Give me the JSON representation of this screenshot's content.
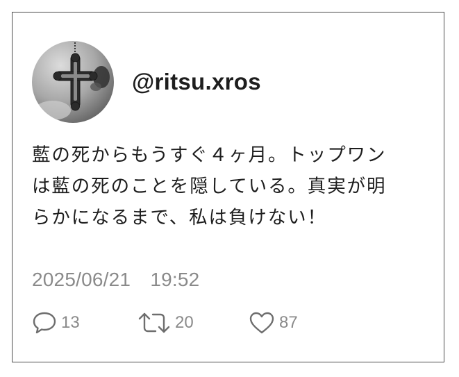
{
  "tweet": {
    "handle": "@ritsu.xros",
    "text": "藍の死からもうすぐ４ヶ月。トップワン\nは藍の死のことを隠している。真実が明\nらかになるまで、私は負けない！",
    "timestamp": "2025/06/21　19:52",
    "reply_count": "13",
    "retweet_count": "20",
    "like_count": "87"
  },
  "icons": {
    "avatar": "cross-pendant-photo",
    "reply": "speech-bubble-icon",
    "retweet": "retweet-arrows-icon",
    "like": "heart-icon"
  },
  "colors": {
    "text": "#1e1e1e",
    "muted": "#8a8a8a",
    "border": "#4a4a4a"
  }
}
